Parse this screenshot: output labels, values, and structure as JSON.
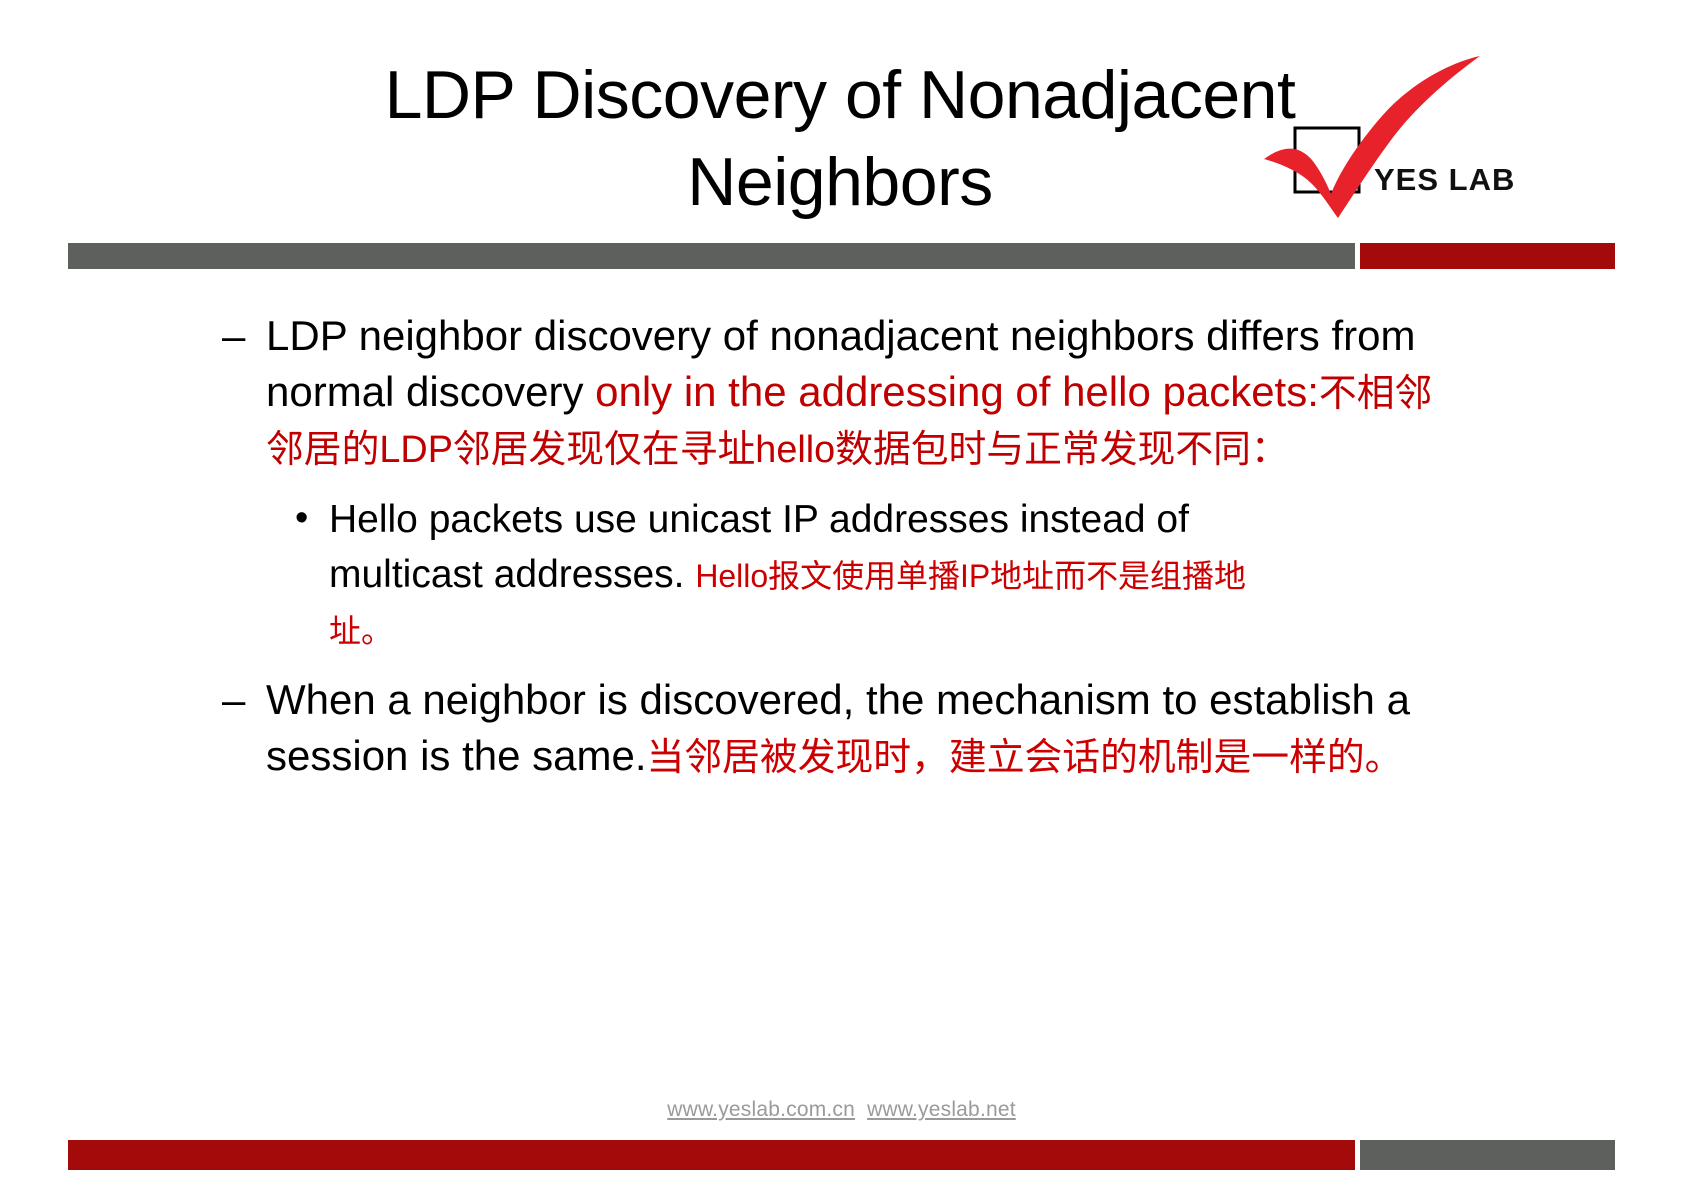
{
  "slide": {
    "title_lines": [
      "LDP Discovery of Nonadjacent",
      "Neighbors"
    ],
    "logo": {
      "text": "YES LAB",
      "check_color": "#e8222a",
      "box_color": "#000000",
      "name": "yes-lab-logo"
    },
    "colors": {
      "bar_gray": "#5e605d",
      "bar_red": "#a30a0a",
      "accent_red": "#cc0000",
      "body_black": "#000000",
      "footer_gray": "#9a9a9a"
    },
    "bullets": [
      {
        "marker": "–",
        "en_black_1": "LDP neighbor discovery of nonadjacent neighbors differs from normal discovery ",
        "en_red": "only in the addressing of hello packets:",
        "cn_red": "不相邻邻居的LDP邻居发现仅在寻址hello数据包时与正常发现不同："
      },
      {
        "marker": "–",
        "en_black_1": "When a neighbor is discovered, the mechanism to establish a session is the same.",
        "en_red": "",
        "cn_red": "当邻居被发现时，建立会话的机制是一样的。"
      }
    ],
    "subbullets": [
      {
        "marker": "•",
        "en_black": "Hello packets use unicast IP addresses instead of multicast addresses. ",
        "cn_red": "Hello报文使用单播IP地址而不是组播地址。"
      }
    ],
    "footer": {
      "link1": "www.yeslab.com.cn",
      "link2": "www.yeslab.net"
    }
  }
}
